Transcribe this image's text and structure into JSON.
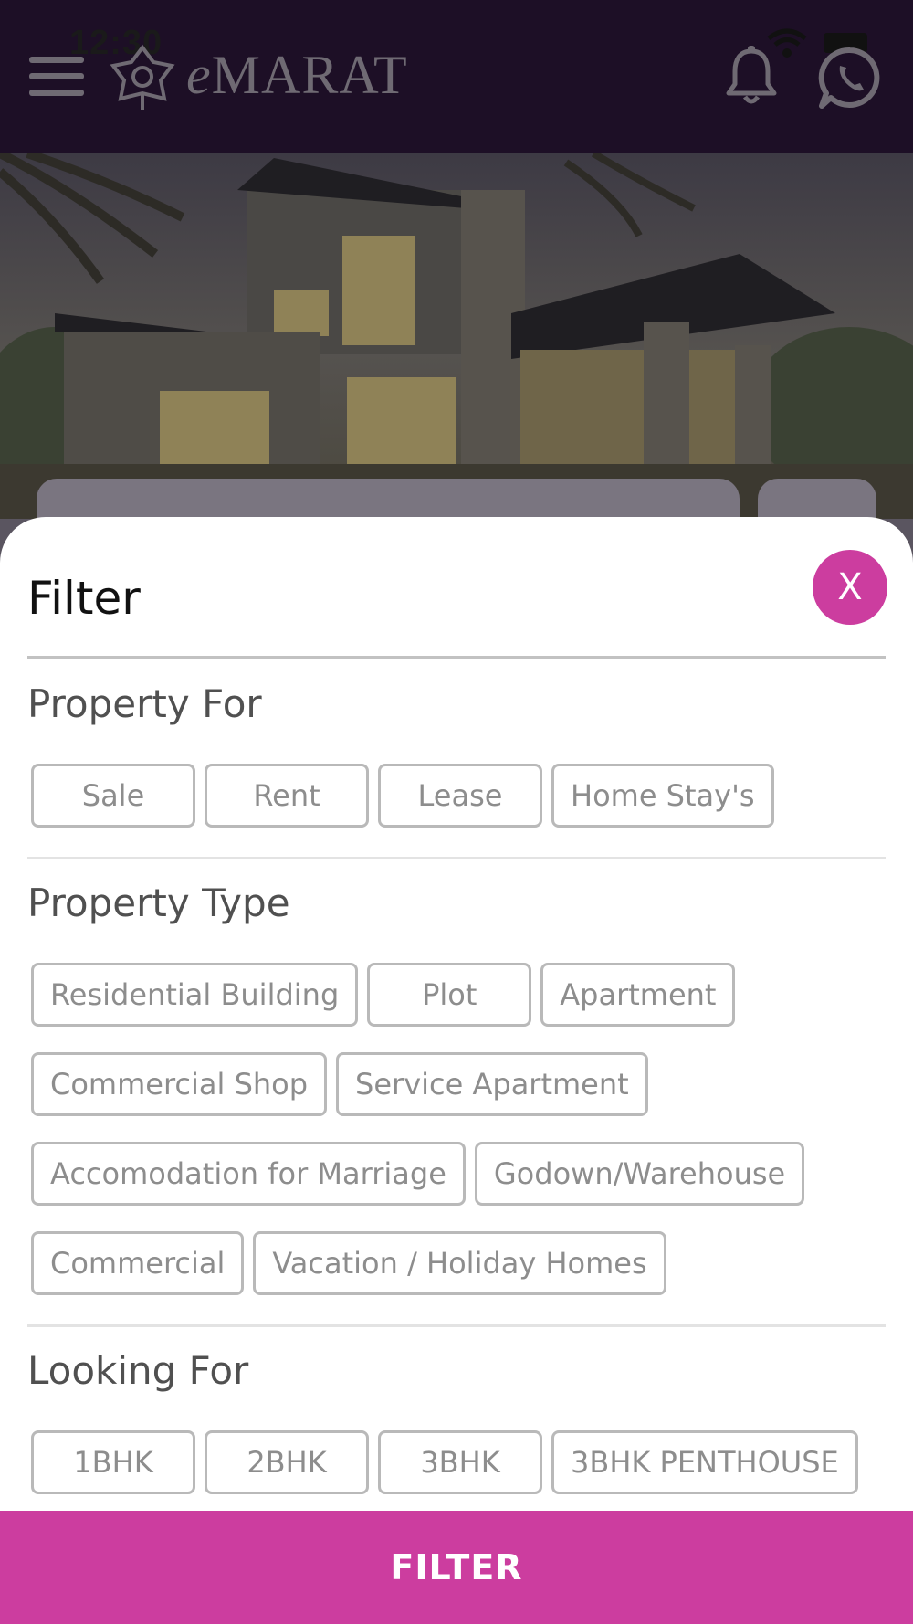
{
  "status_bar": {
    "time": "12:30"
  },
  "app_bar": {
    "logo_prefix": "e",
    "logo_rest": "MARAT",
    "icons": [
      "menu-icon",
      "logo-mark-icon",
      "bell-icon",
      "whatsapp-icon"
    ]
  },
  "filter": {
    "title": "Filter",
    "close_label": "X",
    "sections": [
      {
        "title": "Property For",
        "rows": [
          [
            "Sale",
            "Rent",
            "Lease",
            "Home Stay's"
          ]
        ]
      },
      {
        "title": "Property Type",
        "rows": [
          [
            "Residential Building",
            "Plot",
            "Apartment"
          ],
          [
            "Commercial Shop",
            "Service Apartment"
          ],
          [
            "Accomodation for Marriage",
            "Godown/Warehouse"
          ],
          [
            "Commercial",
            "Vacation / Holiday Homes"
          ]
        ]
      },
      {
        "title": "Looking For",
        "rows": [
          [
            "1BHK",
            "2BHK",
            "3BHK",
            "3BHK PENTHOUSE"
          ]
        ]
      }
    ],
    "apply_label": "FILTER"
  },
  "colors": {
    "accent": "#cc3d9f",
    "app_bar": "#1d0f26",
    "chip_border": "#b9b9b9",
    "chip_text": "#8d8d8d"
  }
}
